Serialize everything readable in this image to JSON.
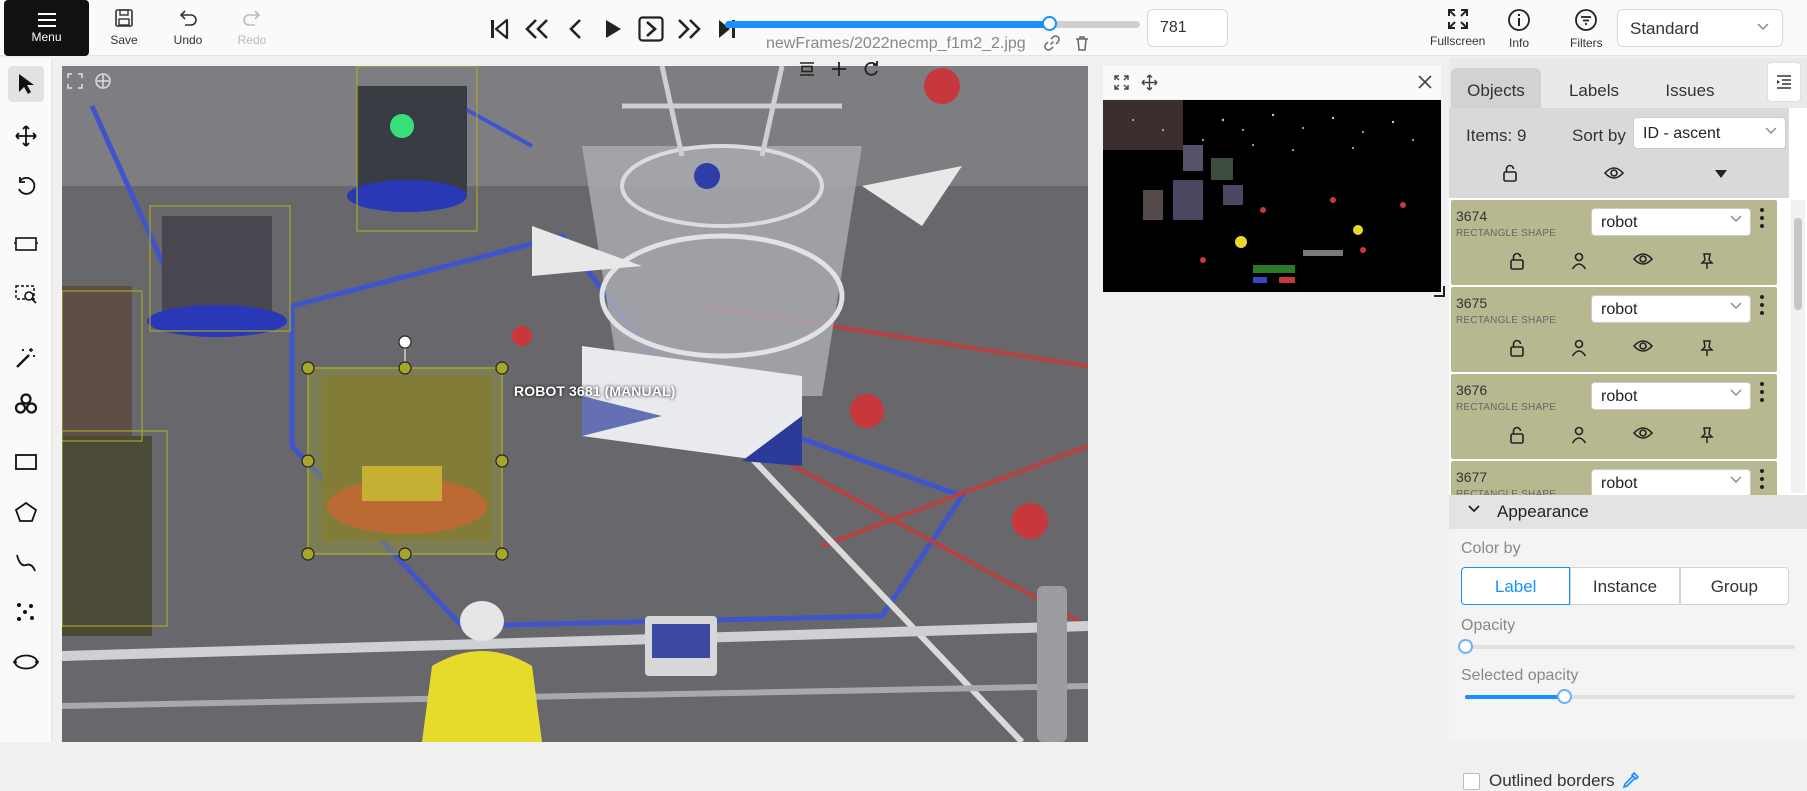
{
  "toolbar": {
    "menu_label": "Menu",
    "save_label": "Save",
    "undo_label": "Undo",
    "redo_label": "Redo",
    "frame_number": "781",
    "frame_progress": 0.78,
    "filename": "newFrames/2022necmp_f1m2_2.jpg",
    "fullscreen_label": "Fullscreen",
    "info_label": "Info",
    "filters_label": "Filters",
    "workspace": "Standard"
  },
  "canvas": {
    "selected_label": "ROBOT 3681 (MANUAL)",
    "annotation_color": "#a6a62a"
  },
  "panel": {
    "tabs": [
      "Objects",
      "Labels",
      "Issues"
    ],
    "items_count": "Items: 9",
    "sort_by_label": "Sort by",
    "sort_value": "ID - ascent",
    "objects": [
      {
        "id": "3674",
        "type": "RECTANGLE SHAPE",
        "label": "robot"
      },
      {
        "id": "3675",
        "type": "RECTANGLE SHAPE",
        "label": "robot"
      },
      {
        "id": "3676",
        "type": "RECTANGLE SHAPE",
        "label": "robot"
      },
      {
        "id": "3677",
        "type": "RECTANGLE SHAPE",
        "label": "robot"
      }
    ],
    "card_color": "#b7b890"
  },
  "appearance": {
    "title": "Appearance",
    "color_by_label": "Color by",
    "color_by_options": [
      "Label",
      "Instance",
      "Group"
    ],
    "color_by_selected": "Label",
    "opacity_label": "Opacity",
    "opacity_value": 0.0,
    "selected_opacity_label": "Selected opacity",
    "selected_opacity_value": 0.3,
    "outlined_borders_label": "Outlined borders",
    "accent": "#1890ff"
  }
}
